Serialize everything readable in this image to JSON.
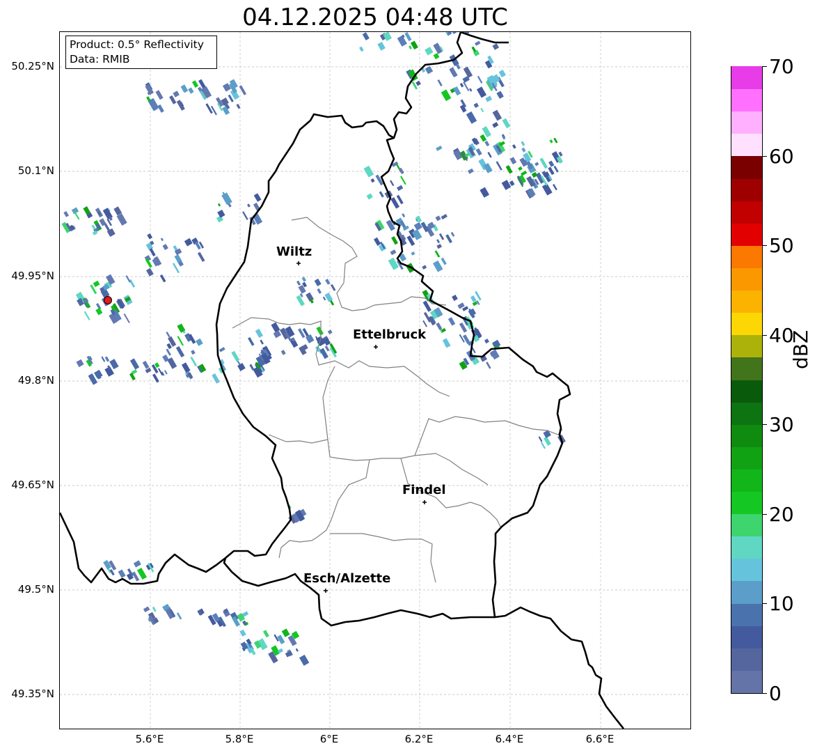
{
  "title": "04.12.2025 04:48 UTC",
  "info_box": {
    "product": "Product: 0.5° Reflectivity",
    "data_source": "Data: RMIB"
  },
  "axes": {
    "y_labels": [
      "50.25°N",
      "50.1°N",
      "49.95°N",
      "49.8°N",
      "49.65°N",
      "49.5°N",
      "49.35°N"
    ],
    "x_labels": [
      "5.6°E",
      "5.8°E",
      "6°E",
      "6.2°E",
      "6.4°E",
      "6.6°E"
    ]
  },
  "cities": [
    {
      "name": "Wiltz"
    },
    {
      "name": "Ettelbruck"
    },
    {
      "name": "Findel"
    },
    {
      "name": "Esch/Alzette"
    }
  ],
  "radar_site": {
    "color": "#e8191b"
  },
  "colorbar": {
    "label": "dBZ",
    "tick_labels": [
      "0",
      "10",
      "20",
      "30",
      "40",
      "50",
      "60",
      "70"
    ],
    "colors": [
      "#6473a8",
      "#55669f",
      "#445a9e",
      "#4a73ad",
      "#5b9ec9",
      "#66c3dc",
      "#5fd7c3",
      "#3ed46e",
      "#14c722",
      "#12b61a",
      "#11a214",
      "#0f8c10",
      "#0c7410",
      "#0a5a0c",
      "#42741c",
      "#adb20b",
      "#fcd704",
      "#fbb300",
      "#fb9800",
      "#fb7900",
      "#e30000",
      "#c10000",
      "#9e0000",
      "#7a0000",
      "#ffe1ff",
      "#ffb1ff",
      "#ff70ff",
      "#e83ce8"
    ]
  },
  "colors": {
    "border": "#000000",
    "canton_lines": "#808080",
    "grid": "#bbbbbb"
  }
}
